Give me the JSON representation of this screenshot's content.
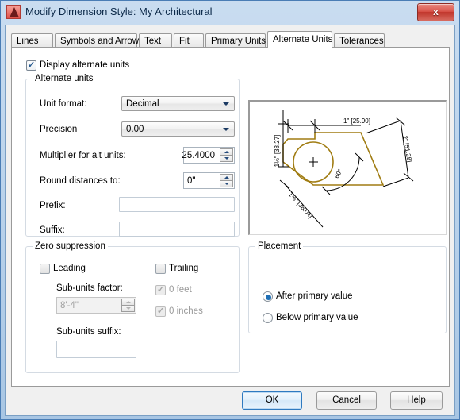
{
  "window": {
    "title": "Modify Dimension Style: My Architectural",
    "icon": "autocad-logo-icon",
    "close_label": "x"
  },
  "tabs": [
    {
      "label": "Lines",
      "active": false
    },
    {
      "label": "Symbols and Arrows",
      "active": false
    },
    {
      "label": "Text",
      "active": false
    },
    {
      "label": "Fit",
      "active": false
    },
    {
      "label": "Primary Units",
      "active": false
    },
    {
      "label": "Alternate Units",
      "active": true
    },
    {
      "label": "Tolerances",
      "active": false
    }
  ],
  "display_alternate_units": {
    "label": "Display alternate units",
    "checked": true
  },
  "alternate_units": {
    "legend": "Alternate units",
    "unit_format": {
      "label": "Unit format:",
      "value": "Decimal"
    },
    "precision": {
      "label": "Precision",
      "value": "0.00"
    },
    "multiplier": {
      "label": "Multiplier for alt units:",
      "value": "25.4000"
    },
    "round_distances": {
      "label": "Round distances  to:",
      "value": "0\""
    },
    "prefix": {
      "label": "Prefix:",
      "value": ""
    },
    "suffix": {
      "label": "Suffix:",
      "value": ""
    }
  },
  "zero_suppression": {
    "legend": "Zero suppression",
    "leading": {
      "label": "Leading",
      "checked": false
    },
    "trailing": {
      "label": "Trailing",
      "checked": false
    },
    "zero_feet": {
      "label": "0 feet",
      "checked": true,
      "disabled": true
    },
    "zero_inches": {
      "label": "0 inches",
      "checked": true,
      "disabled": true
    },
    "sub_units_factor": {
      "label": "Sub-units factor:",
      "value": "8'-4\"",
      "disabled": true
    },
    "sub_units_suffix": {
      "label": "Sub-units suffix:",
      "value": ""
    }
  },
  "placement": {
    "legend": "Placement",
    "options": [
      {
        "label": "After primary value",
        "selected": true
      },
      {
        "label": "Below primary value",
        "selected": false
      }
    ]
  },
  "preview": {
    "name": "dimension-style-preview",
    "dim_top": "1\" [25.90]",
    "dim_left": "1½\" [38.27]",
    "dim_right": "2\" [51.28]",
    "dim_bottom_left": "1⅝\" [38.04]",
    "dim_angle": "60°",
    "geometry_color": "#a07c12",
    "dimension_color": "#000000"
  },
  "buttons": {
    "ok": "OK",
    "cancel": "Cancel",
    "help": "Help"
  },
  "colors": {
    "title_gradient_start": "#c9dcf0",
    "title_gradient_end": "#a8c6e4",
    "dialog_bg": "#f0f0f0",
    "panel_bg": "#ffffff",
    "accent": "#1f6fb5",
    "close_red": "#d9544a"
  }
}
